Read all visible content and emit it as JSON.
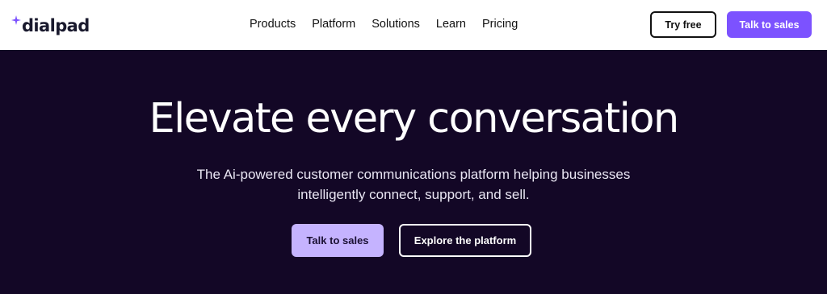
{
  "header": {
    "logo_text": "dialpad",
    "logo_icon": "sparkle-icon",
    "nav": [
      "Products",
      "Platform",
      "Solutions",
      "Learn",
      "Pricing"
    ],
    "try_free_label": "Try free",
    "talk_to_sales_label": "Talk to sales"
  },
  "hero": {
    "title": "Elevate every conversation",
    "subtitle_line1": "The Ai-powered customer communications platform helping businesses",
    "subtitle_line2": "intelligently connect, support, and sell.",
    "primary_cta_label": "Talk to sales",
    "secondary_cta_label": "Explore the platform"
  },
  "colors": {
    "accent": "#7c52ff",
    "hero_background": "#130726",
    "hero_primary_button": "#c5b3ff",
    "nav_background": "#ffffff"
  }
}
